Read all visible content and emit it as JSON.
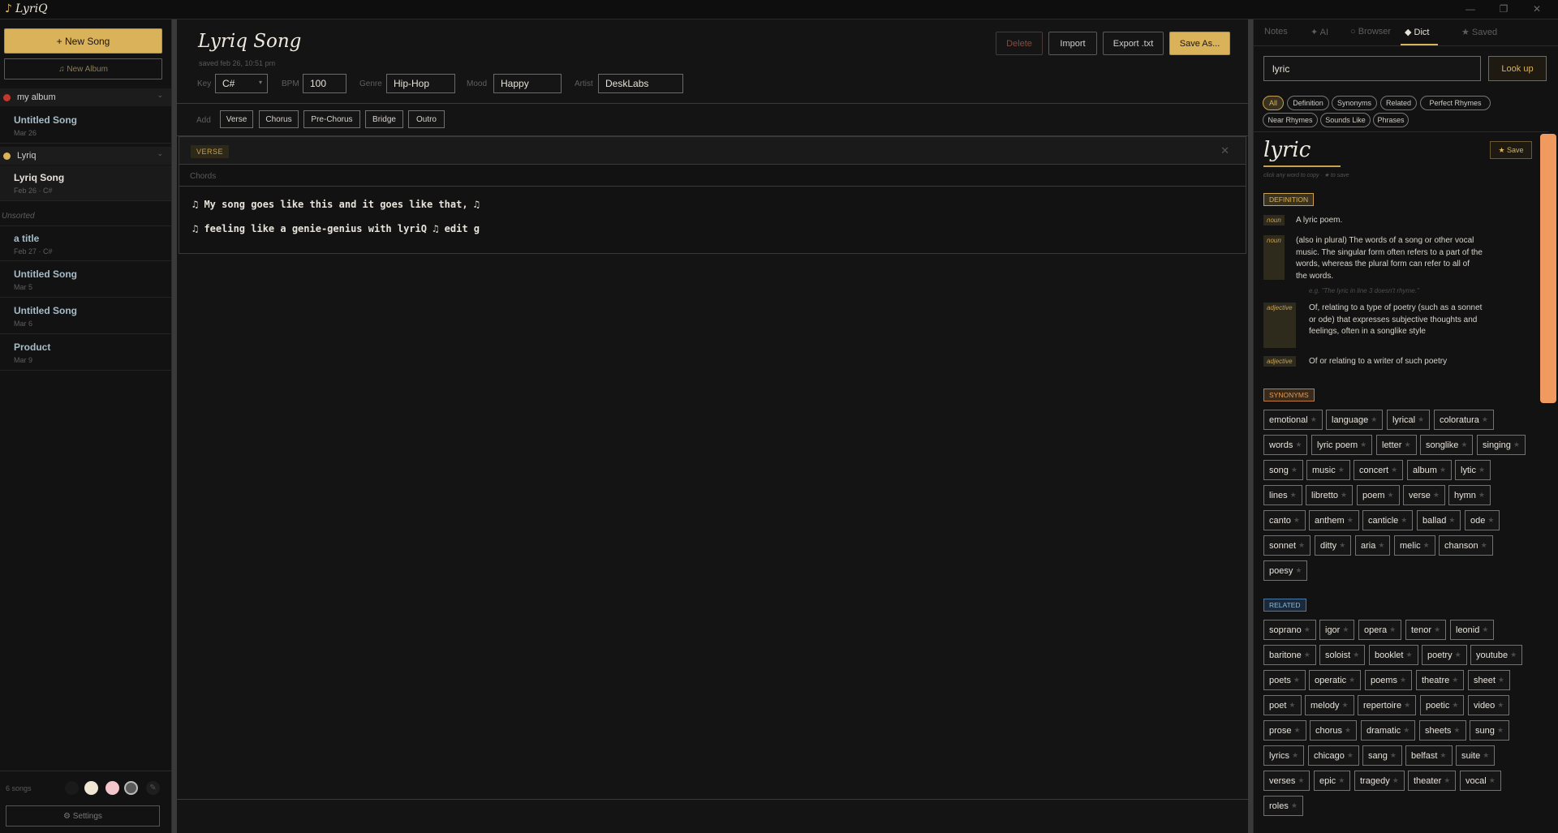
{
  "app": {
    "title": "LyriQ"
  },
  "sidebar": {
    "new_song_label": "+  New Song",
    "new_album_label": "♫ New Album",
    "albums": [
      {
        "name": "my album",
        "color": "#c0392b"
      },
      {
        "name": "Lyriq",
        "color": "#d9b25a"
      }
    ],
    "songs": [
      {
        "title": "Untitled Song",
        "meta": "Mar 26"
      },
      {
        "title": "Lyriq Song",
        "meta": "Feb 26  ·  C#"
      },
      {
        "title": "a title",
        "meta": "Feb 27  ·  C#"
      },
      {
        "title": "Untitled Song",
        "meta": "Mar 5"
      },
      {
        "title": "Untitled Song",
        "meta": "Mar 6"
      },
      {
        "title": "Product",
        "meta": "Mar 9"
      }
    ],
    "unsorted_label": "Unsorted",
    "song_count": "6 songs",
    "theme_swatches": [
      "#1a1a1a",
      "#efe6d4",
      "#f2c6cc",
      "#5a5a5a"
    ],
    "settings_label": "⚙ Settings"
  },
  "editor": {
    "title": "Lyriq Song",
    "saved": "saved feb 26, 10:51 pm",
    "buttons": {
      "delete": "Delete",
      "import": "Import",
      "export": "Export .txt",
      "save_as": "Save As..."
    },
    "key_label": "Key",
    "key_value": "C#",
    "bpm_label": "BPM",
    "bpm_value": "100",
    "genre_label": "Genre",
    "genre_value": "Hip-Hop",
    "mood_label": "Mood",
    "mood_value": "Happy",
    "artist_label": "Artist",
    "artist_value": "DeskLabs",
    "add_label": "Add",
    "sections": [
      "Verse",
      "Chorus",
      "Pre-Chorus",
      "Bridge",
      "Outro"
    ],
    "block": {
      "tag": "VERSE",
      "chords_placeholder": "Chords",
      "lines": [
        "♫ My song goes like this and it goes like that, ♫",
        "♫ feeling like a genie-genius with lyriQ ♫ edit g"
      ]
    }
  },
  "panel": {
    "tabs": [
      "Notes",
      "✦ AI",
      "○ Browser",
      "◆ Dict",
      "★ Saved"
    ],
    "search_value": "lyric",
    "lookup_label": "Look up",
    "filters": [
      "All",
      "Definition",
      "Synonyms",
      "Related",
      "Perfect Rhymes",
      "Near Rhymes",
      "Sounds Like",
      "Phrases"
    ],
    "word": "lyric",
    "hint": "click any word to copy · ★ to save",
    "save_label": "★ Save",
    "definition_label": "DEFINITION",
    "definitions": [
      {
        "pos": "noun",
        "text": "A lyric poem."
      },
      {
        "pos": "noun",
        "text": "(also in plural) The words of a song or other vocal music. The singular form often refers to a part of the words, whereas the plural form can refer to all of the words.",
        "example": "e.g. \"The lyric in line 3 doesn't rhyme.\""
      },
      {
        "pos": "adjective",
        "text": "Of, relating to a type of poetry (such as a sonnet or ode) that expresses subjective thoughts and feelings, often in a songlike style"
      },
      {
        "pos": "adjective",
        "text": "Of or relating to a writer of such poetry"
      }
    ],
    "synonyms_label": "SYNONYMS",
    "synonyms": [
      "emotional",
      "language",
      "lyrical",
      "coloratura",
      "words",
      "lyric poem",
      "letter",
      "songlike",
      "singing",
      "song",
      "music",
      "concert",
      "album",
      "lytic",
      "lines",
      "libretto",
      "poem",
      "verse",
      "hymn",
      "canto",
      "anthem",
      "canticle",
      "ballad",
      "ode",
      "sonnet",
      "ditty",
      "aria",
      "melic",
      "chanson",
      "poesy"
    ],
    "related_label": "RELATED",
    "related": [
      "soprano",
      "igor",
      "opera",
      "tenor",
      "leonid",
      "baritone",
      "soloist",
      "booklet",
      "poetry",
      "youtube",
      "poets",
      "operatic",
      "poems",
      "theatre",
      "sheet",
      "poet",
      "melody",
      "repertoire",
      "poetic",
      "video",
      "prose",
      "chorus",
      "dramatic",
      "sheets",
      "sung",
      "lyrics",
      "chicago",
      "sang",
      "belfast",
      "suite",
      "verses",
      "epic",
      "tragedy",
      "theater",
      "vocal",
      "roles"
    ]
  }
}
